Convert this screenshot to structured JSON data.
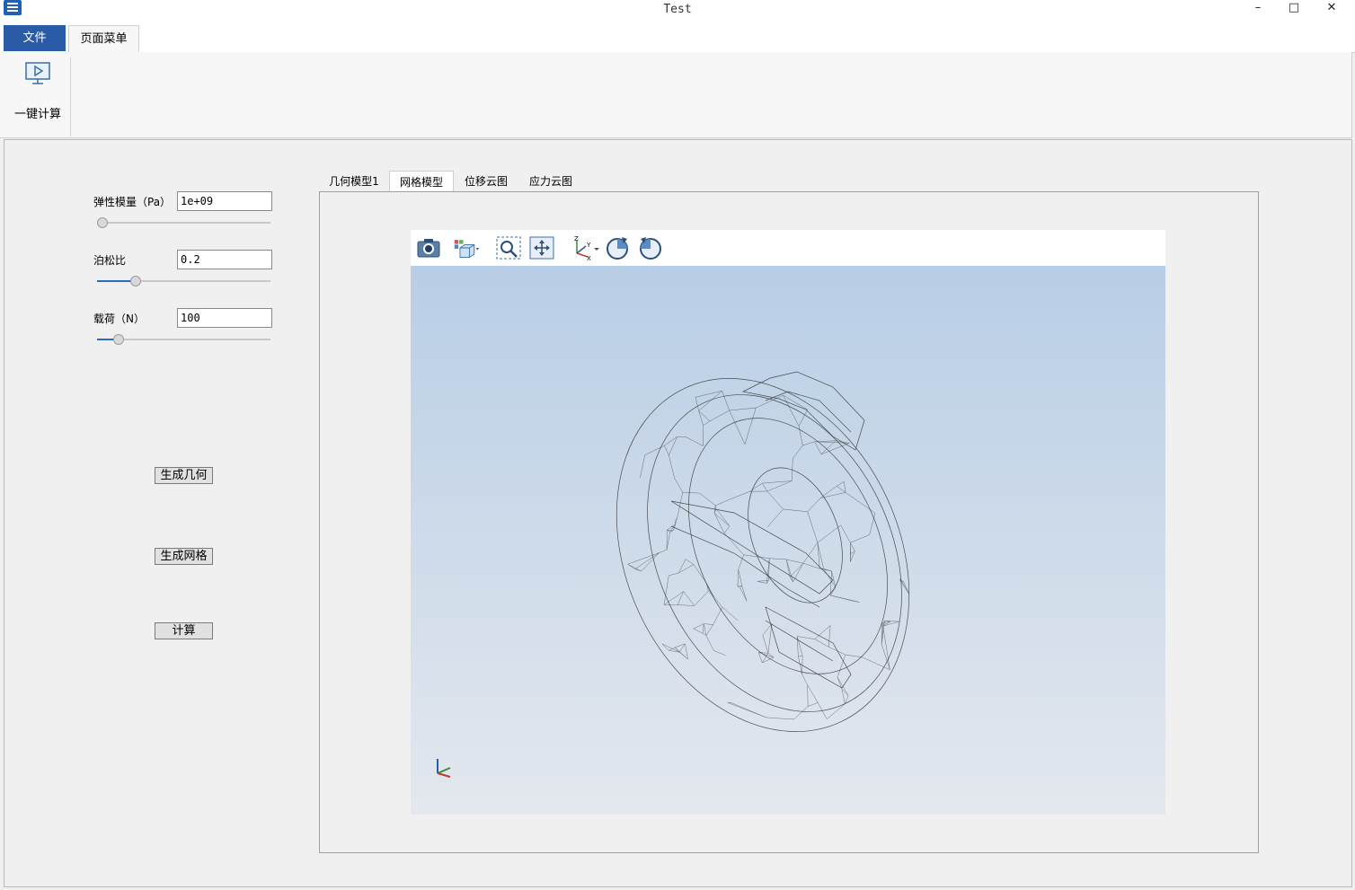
{
  "window": {
    "title": "Test",
    "minimize": "–",
    "maximize": "□",
    "close": "✕"
  },
  "menu": {
    "file": "文件",
    "page_menu": "页面菜单"
  },
  "ribbon": {
    "one_click_calc": "一键计算",
    "icon": "monitor-play-icon"
  },
  "params": {
    "elastic_label": "弹性模量（Pa）",
    "elastic_value": "1e+09",
    "elastic_slider": 0.0,
    "poisson_label": "泊松比",
    "poisson_value": "0.2",
    "poisson_slider": 0.2,
    "load_label": "载荷（N）",
    "load_value": "100",
    "load_slider": 0.1
  },
  "buttons": {
    "gen_geometry": "生成几何",
    "gen_mesh": "生成网格",
    "compute": "计算"
  },
  "tabs": [
    {
      "label": "几何模型1",
      "active": false
    },
    {
      "label": "网格模型",
      "active": true
    },
    {
      "label": "位移云图",
      "active": false
    },
    {
      "label": "应力云图",
      "active": false
    }
  ],
  "viewer_tools": [
    "camera-icon",
    "view-cube-icon",
    "zoom-box-icon",
    "fit-all-icon",
    "axes-orientation-icon",
    "rotate-cw-icon",
    "rotate-ccw-icon"
  ],
  "triad": {
    "x": "X",
    "y": "Y",
    "z": "Z"
  },
  "colors": {
    "accent": "#2a5ba6",
    "bg_top": "#b8cee6",
    "bg_bottom": "#e4e8ee"
  }
}
